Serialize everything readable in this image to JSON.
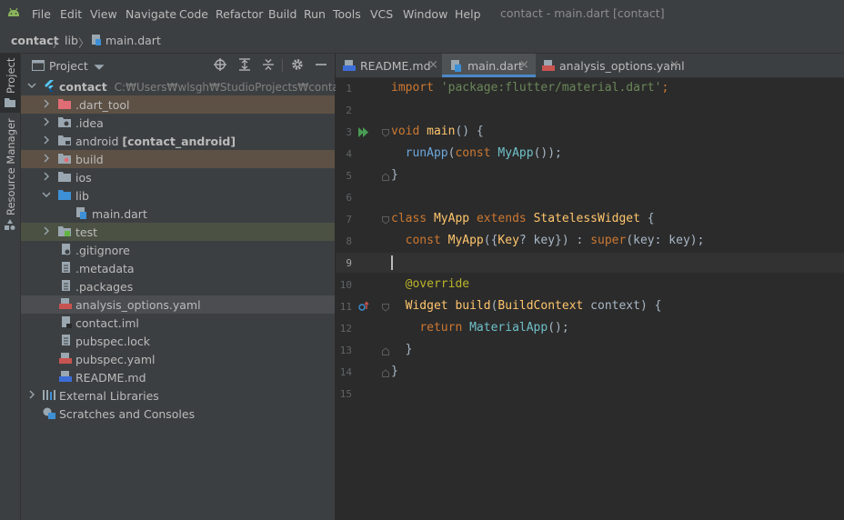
{
  "menu": {
    "items": [
      "File",
      "Edit",
      "View",
      "Navigate",
      "Code",
      "Refactor",
      "Build",
      "Run",
      "Tools",
      "VCS",
      "Window",
      "Help"
    ],
    "window_title": "contact - main.dart [contact]"
  },
  "breadcrumb": {
    "project": "contact",
    "folder": "lib",
    "file": "main.dart"
  },
  "side_tabs": {
    "project": "Project",
    "resource_manager": "Resource Manager"
  },
  "project_panel": {
    "title": "Project",
    "root_name": "contact",
    "root_path": "C:₩Users₩wlsgh₩StudioProjects₩contact",
    "items": [
      {
        "label": ".dart_tool",
        "suffix": ""
      },
      {
        "label": ".idea",
        "suffix": ""
      },
      {
        "label": "android",
        "suffix": "[contact_android]"
      },
      {
        "label": "build",
        "suffix": ""
      },
      {
        "label": "ios",
        "suffix": ""
      },
      {
        "label": "lib",
        "suffix": ""
      },
      {
        "label": "main.dart",
        "suffix": ""
      },
      {
        "label": "test",
        "suffix": ""
      },
      {
        "label": ".gitignore",
        "suffix": ""
      },
      {
        "label": ".metadata",
        "suffix": ""
      },
      {
        "label": ".packages",
        "suffix": ""
      },
      {
        "label": "analysis_options.yaml",
        "suffix": ""
      },
      {
        "label": "contact.iml",
        "suffix": ""
      },
      {
        "label": "pubspec.lock",
        "suffix": ""
      },
      {
        "label": "pubspec.yaml",
        "suffix": ""
      },
      {
        "label": "README.md",
        "suffix": ""
      },
      {
        "label": "External Libraries",
        "suffix": ""
      },
      {
        "label": "Scratches and Consoles",
        "suffix": ""
      }
    ]
  },
  "editor_tabs": [
    {
      "label": "README.md",
      "close": "×"
    },
    {
      "label": "main.dart",
      "close": "×"
    },
    {
      "label": "analysis_options.yaml",
      "close": "×"
    }
  ],
  "line_numbers": [
    "1",
    "2",
    "3",
    "4",
    "5",
    "6",
    "7",
    "8",
    "9",
    "10",
    "11",
    "12",
    "13",
    "14",
    "15"
  ],
  "code": {
    "l1_kw": "import",
    "l1_str": "'package:flutter/material.dart'",
    "l1_end": ";",
    "l3_kw": "void",
    "l3_fn": "main",
    "l3_end": "() {",
    "l4_call": "runApp",
    "l4_p1": "(",
    "l4_kw": "const",
    "l4_cls": "MyApp",
    "l4_end": "());",
    "l5": "}",
    "l7_kw1": "class",
    "l7_cls": "MyApp",
    "l7_kw2": "extends",
    "l7_cls2": "StatelessWidget",
    "l7_end": " {",
    "l8_kw": "const",
    "l8_cls": "MyApp",
    "l8_p1": "({",
    "l8_typ": "Key",
    "l8_p2": "? key}) : ",
    "l8_kw2": "super",
    "l8_p3": "(key: key);",
    "l10_ann": "@override",
    "l11_cls": "Widget",
    "l11_fn": "build",
    "l11_p1": "(",
    "l11_cls2": "BuildContext",
    "l11_p2": " context) {",
    "l12_kw": "return",
    "l12_cls": "MaterialApp",
    "l12_end": "();",
    "l13": "}",
    "l14": "}"
  },
  "colors": {
    "accent": "#4a88c7",
    "panel_bg": "#3c3f41",
    "editor_bg": "#2b2b2b",
    "selection": "#4b4d51",
    "highlight_brown": "#5d5145",
    "highlight_green": "#4b5244"
  }
}
